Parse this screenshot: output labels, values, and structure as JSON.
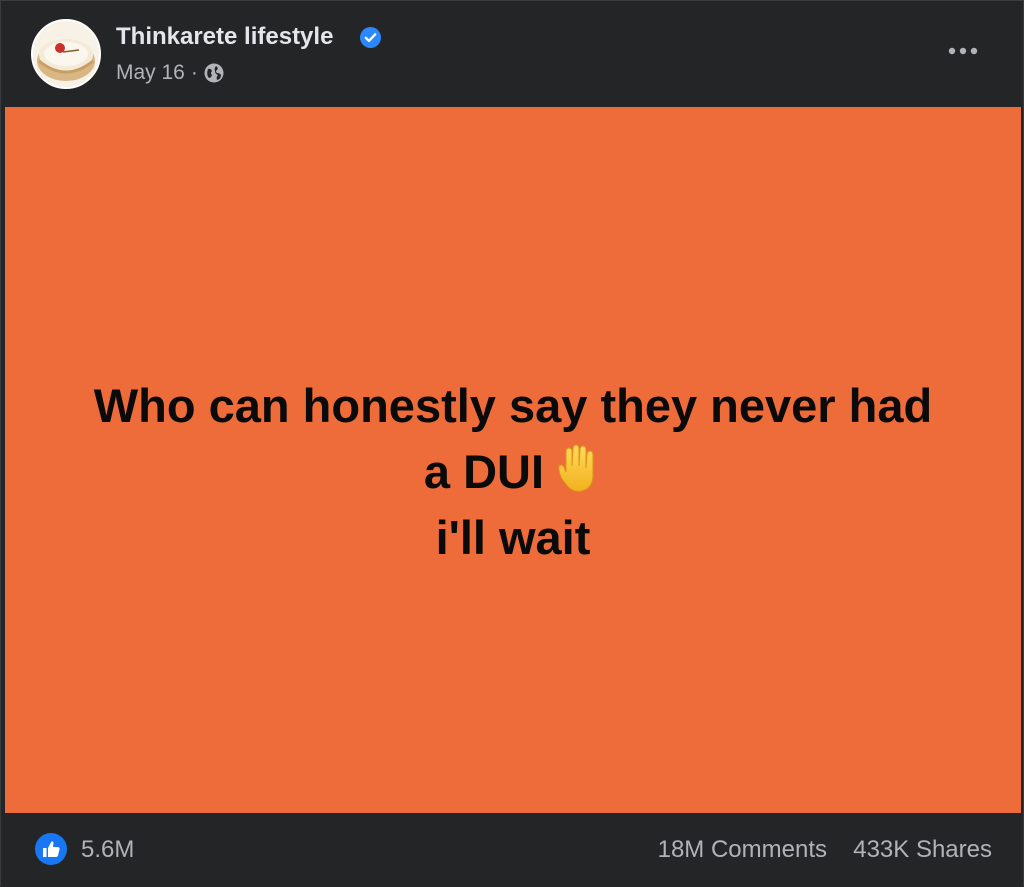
{
  "post": {
    "page_name": "Thinkarete lifestyle",
    "date": "May 16",
    "separator": "·",
    "privacy_icon": "globe-icon",
    "verified_icon": "verified-badge-icon",
    "more_icon": "more-options-icon",
    "background_color": "#ee6c3a",
    "text_lines": [
      "Who can honestly say they never had",
      "a DUI",
      "i'll wait"
    ],
    "emoji_icon": "raised-hand-icon"
  },
  "footer": {
    "reaction_icon": "like-icon",
    "reaction_count": "5.6M",
    "comments": "18M Comments",
    "shares": "433K Shares"
  },
  "colors": {
    "accent": "#1877f2",
    "card_bg": "#242526",
    "text_primary": "#e4e6eb",
    "text_secondary": "#b0b3b8"
  }
}
